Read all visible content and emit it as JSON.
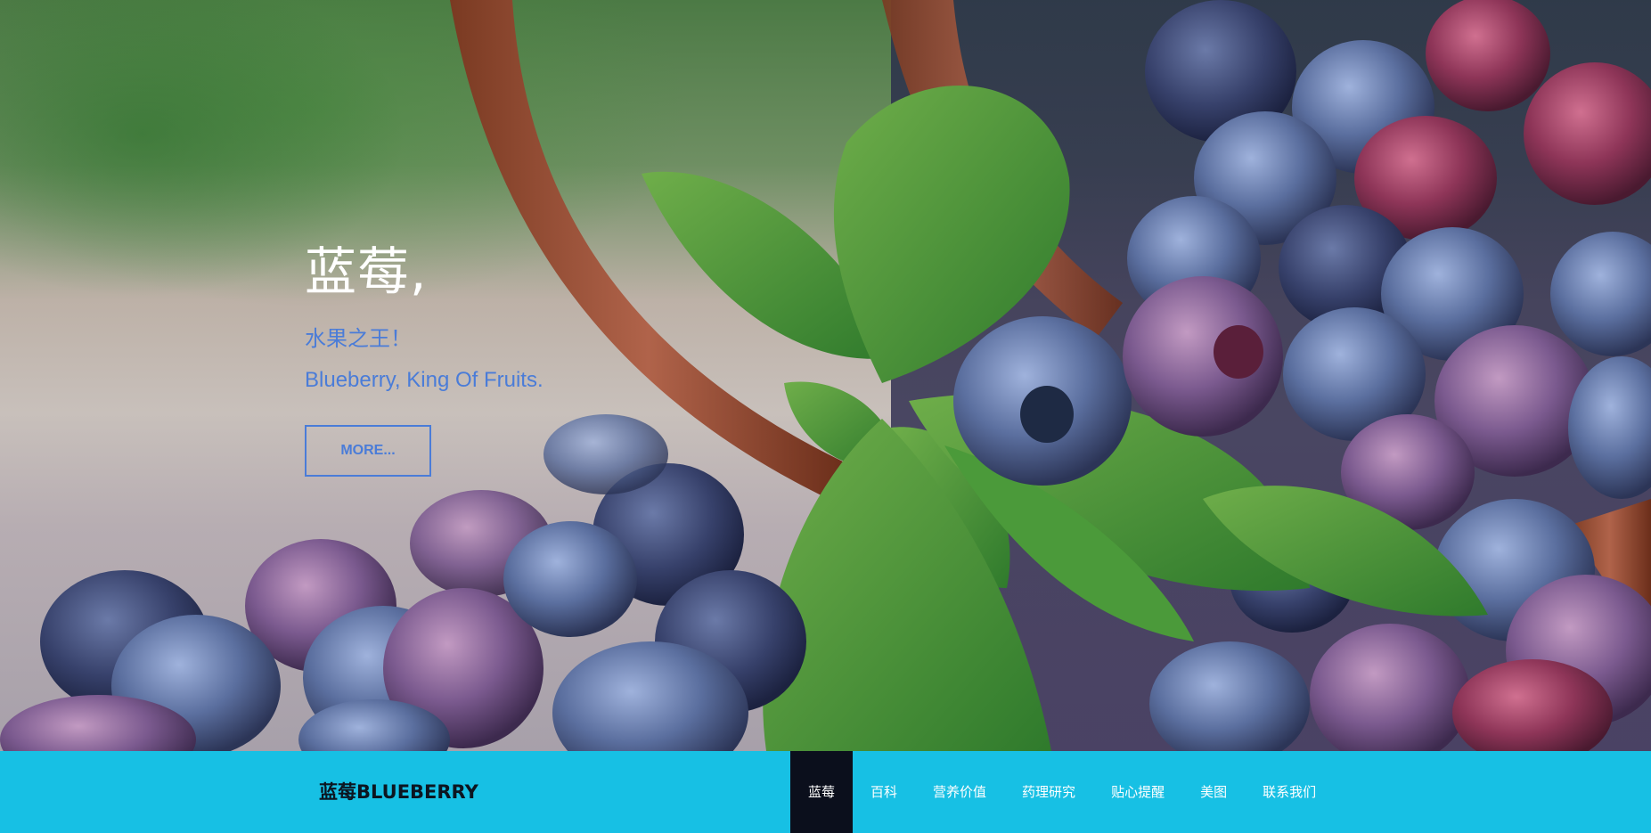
{
  "hero": {
    "title": "蓝莓,",
    "subtitle_cn": "水果之王！",
    "subtitle_en": "Blueberry, King Of Fruits.",
    "button_label": "MORE...",
    "accent_color": "#4a7cd8"
  },
  "navbar": {
    "brand": "蓝莓BLUEBERRY",
    "background_color": "#17c0e4",
    "active_color": "#0b0f1c",
    "items": [
      {
        "label": "蓝莓",
        "active": true
      },
      {
        "label": "百科",
        "active": false
      },
      {
        "label": "营养价值",
        "active": false
      },
      {
        "label": "药理研究",
        "active": false
      },
      {
        "label": "贴心提醒",
        "active": false
      },
      {
        "label": "美图",
        "active": false
      },
      {
        "label": "联系我们",
        "active": false
      }
    ]
  }
}
